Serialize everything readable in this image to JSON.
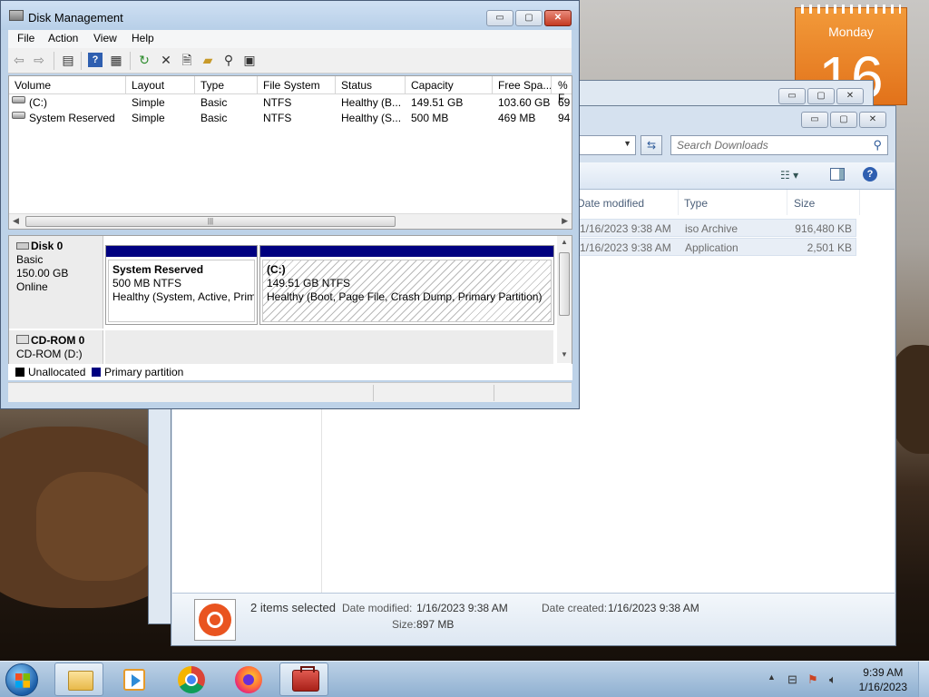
{
  "calendar": {
    "weekday": "Monday",
    "day": "16"
  },
  "back_window": {
    "min": "▭",
    "max": "▢",
    "close": "✕"
  },
  "explorer": {
    "search_placeholder": "Search Downloads",
    "columns": [
      "Date modified",
      "Type",
      "Size"
    ],
    "files": [
      {
        "date": "1/16/2023 9:38 AM",
        "type": "iso Archive",
        "size": "916,480 KB"
      },
      {
        "date": "1/16/2023 9:38 AM",
        "type": "Application",
        "size": "2,501 KB"
      }
    ],
    "details": {
      "selected": "2 items selected",
      "date_modified_label": "Date modified:",
      "date_modified": "1/16/2023 9:38 AM",
      "date_created_label": "Date created:",
      "date_created": "1/16/2023 9:38 AM",
      "size_label": "Size:",
      "size": "897 MB"
    }
  },
  "disk_management": {
    "title": "Disk Management",
    "menu": [
      "File",
      "Action",
      "View",
      "Help"
    ],
    "columns": [
      "Volume",
      "Layout",
      "Type",
      "File System",
      "Status",
      "Capacity",
      "Free Spa...",
      "% F"
    ],
    "volumes": [
      {
        "volume": "(C:)",
        "layout": "Simple",
        "type": "Basic",
        "fs": "NTFS",
        "status": "Healthy (B...",
        "capacity": "149.51 GB",
        "free": "103.60 GB",
        "pct": "69"
      },
      {
        "volume": "System Reserved",
        "layout": "Simple",
        "type": "Basic",
        "fs": "NTFS",
        "status": "Healthy (S...",
        "capacity": "500 MB",
        "free": "469 MB",
        "pct": "94"
      }
    ],
    "disk0": {
      "name": "Disk 0",
      "kind": "Basic",
      "size": "150.00 GB",
      "state": "Online",
      "partitions": [
        {
          "name": "System Reserved",
          "fs": "500 MB NTFS",
          "status": "Healthy (System, Active, Primary Partition)"
        },
        {
          "name": "(C:)",
          "fs": "149.51 GB NTFS",
          "status": "Healthy (Boot, Page File, Crash Dump, Primary Partition)"
        }
      ]
    },
    "cdrom": {
      "name": "CD-ROM 0",
      "drive": "CD-ROM (D:)"
    },
    "legend": [
      {
        "label": "Unallocated",
        "color": "#000000"
      },
      {
        "label": "Primary partition",
        "color": "#000080"
      }
    ]
  },
  "taskbar": {
    "time": "9:39 AM",
    "date": "1/16/2023"
  },
  "colors": {
    "partition_bar": "#000080",
    "close_red": "#c43a22",
    "calendar_orange": "#e2721a"
  }
}
